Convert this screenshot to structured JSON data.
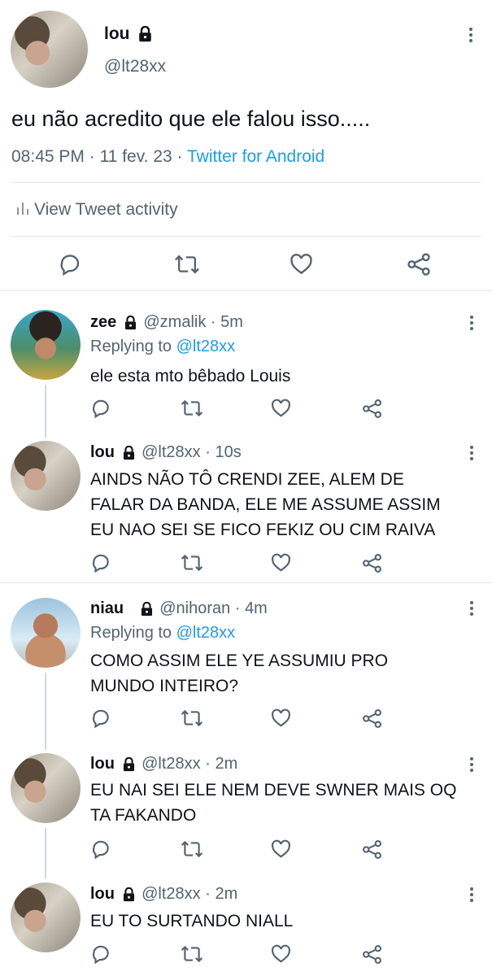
{
  "main_tweet": {
    "name": "lou",
    "handle": "@lt28xx",
    "text": "eu não acredito que ele falou isso.....",
    "time": "08:45 PM",
    "date": "11 fev. 23",
    "source": "Twitter for Android",
    "activity_label": "View Tweet activity"
  },
  "replies": [
    {
      "name": "zee",
      "handle": "@zmalik",
      "time": "5m",
      "replying_prefix": "Replying to",
      "replying_to": "@lt28xx",
      "lines": [
        "ele esta mto bêbado Louis"
      ]
    },
    {
      "name": "lou",
      "handle": "@lt28xx",
      "time": "10s",
      "lines": [
        "AINDS NÃO TÔ CRENDI ZEE, ALEM DE",
        "FALAR DA BANDA, ELE ME ASSUME ASSIM",
        "EU NAO SEI SE FICO FEKIZ OU CIM RAIVA"
      ]
    },
    {
      "name": "niau",
      "handle": "@nihoran",
      "time": "4m",
      "replying_prefix": "Replying to",
      "replying_to": "@lt28xx",
      "lines": [
        "COMO ASSIM ELE YE ASSUMIU PRO",
        "MUNDO INTEIRO?"
      ]
    },
    {
      "name": "lou",
      "handle": "@lt28xx",
      "time": "2m",
      "lines": [
        "EU NAI SEI ELE NEM DEVE SWNER MAIS OQ",
        "TA FAKANDO"
      ]
    },
    {
      "name": "lou",
      "handle": "@lt28xx",
      "time": "2m",
      "lines": [
        "EU TO SURTANDO NIALL"
      ]
    }
  ],
  "icons": [
    "lock-icon",
    "more-icon",
    "reply-icon",
    "retweet-icon",
    "like-icon",
    "share-icon",
    "activity-icon"
  ],
  "colors": {
    "link": "#1d9bf0",
    "secondary_text": "#536471",
    "divider": "#e3e6e8"
  }
}
